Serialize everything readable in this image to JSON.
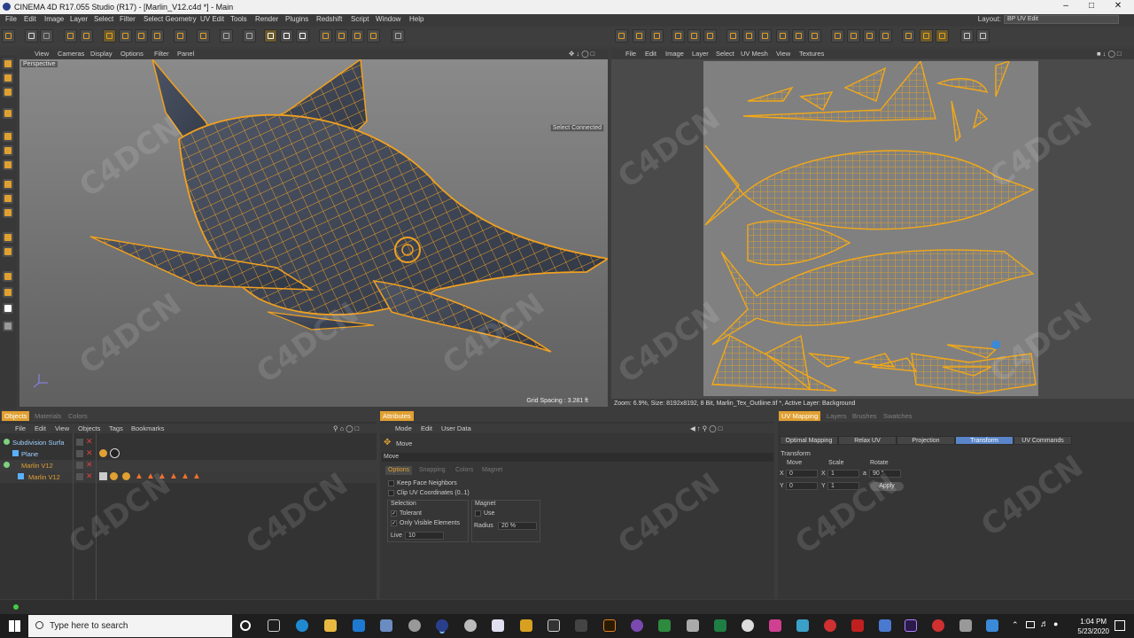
{
  "app": {
    "title": "CINEMA 4D R17.055 Studio (R17) - [Marlin_V12.c4d *] - Main",
    "layout_label": "Layout:",
    "layout_value": "BP UV Edit"
  },
  "menu": [
    "File",
    "Edit",
    "Image",
    "Layer",
    "Select",
    "Filter",
    "Select Geometry",
    "UV Edit",
    "Tools",
    "Render",
    "Plugins",
    "Redshift",
    "Script",
    "Window",
    "Help"
  ],
  "viewport": {
    "menu": [
      "View",
      "Cameras",
      "Display",
      "Options",
      "Filter",
      "Panel"
    ],
    "label": "Perspective",
    "select_connected": "Select Connected",
    "grid_spacing": "Grid Spacing : 3.281 ft"
  },
  "uv_view": {
    "menu": [
      "File",
      "Edit",
      "Image",
      "Layer",
      "Select",
      "UV Mesh",
      "View",
      "Textures"
    ],
    "status": "Zoom: 6.9%, Size: 8192x8192, 8 Bit, Marlin_Tex_Outliine.tif *, Active Layer: Background"
  },
  "objects_panel": {
    "tabs": [
      "Objects",
      "Materials",
      "Colors"
    ],
    "menu": [
      "File",
      "Edit",
      "View",
      "Objects",
      "Tags",
      "Bookmarks"
    ],
    "rows": [
      {
        "name": "Subdivision Surfa",
        "color": "#9ed0ff"
      },
      {
        "name": "Plane",
        "color": "#9ed0ff"
      },
      {
        "name": "Marlin V12",
        "color": "#e0a032"
      },
      {
        "name": "Marlin V12",
        "color": "#e0a032"
      }
    ]
  },
  "attributes_panel": {
    "tab": "Attributes",
    "menu": [
      "Mode",
      "Edit",
      "User Data"
    ],
    "tool": "Move",
    "section": "Move",
    "subtabs": [
      "Options",
      "Snapping",
      "Colors",
      "Magnet"
    ],
    "keep_face_neighbors": "Keep Face Neighbors",
    "clip_uv": "Clip UV Coordinates (0..1)",
    "selection_label": "Selection",
    "tolerant": "Tolerant",
    "only_visible": "Only Visible Elements",
    "live_label": "Live",
    "live_value": "10",
    "magnet_label": "Magnet",
    "use_label": "Use",
    "radius_label": "Radius",
    "radius_value": "20 %"
  },
  "uv_panel": {
    "tabs": [
      "UV Mapping",
      "Layers",
      "Brushes",
      "Swatches"
    ],
    "buttons": [
      "Optimal Mapping",
      "Relax UV",
      "Projection",
      "Transform",
      "UV Commands"
    ],
    "section": "Transform",
    "move_label": "Move",
    "scale_label": "Scale",
    "rotate_label": "Rotate",
    "x_label": "X",
    "y_label": "Y",
    "move_x": "0",
    "move_y": "0",
    "scale_x": "1",
    "scale_y": "1",
    "rotate_a": "a",
    "rotate_value": "90 °",
    "apply": "Apply"
  },
  "taskbar": {
    "search_placeholder": "Type here to search",
    "time": "1:04 PM",
    "date": "5/23/2020"
  },
  "watermark": "C4DCN"
}
